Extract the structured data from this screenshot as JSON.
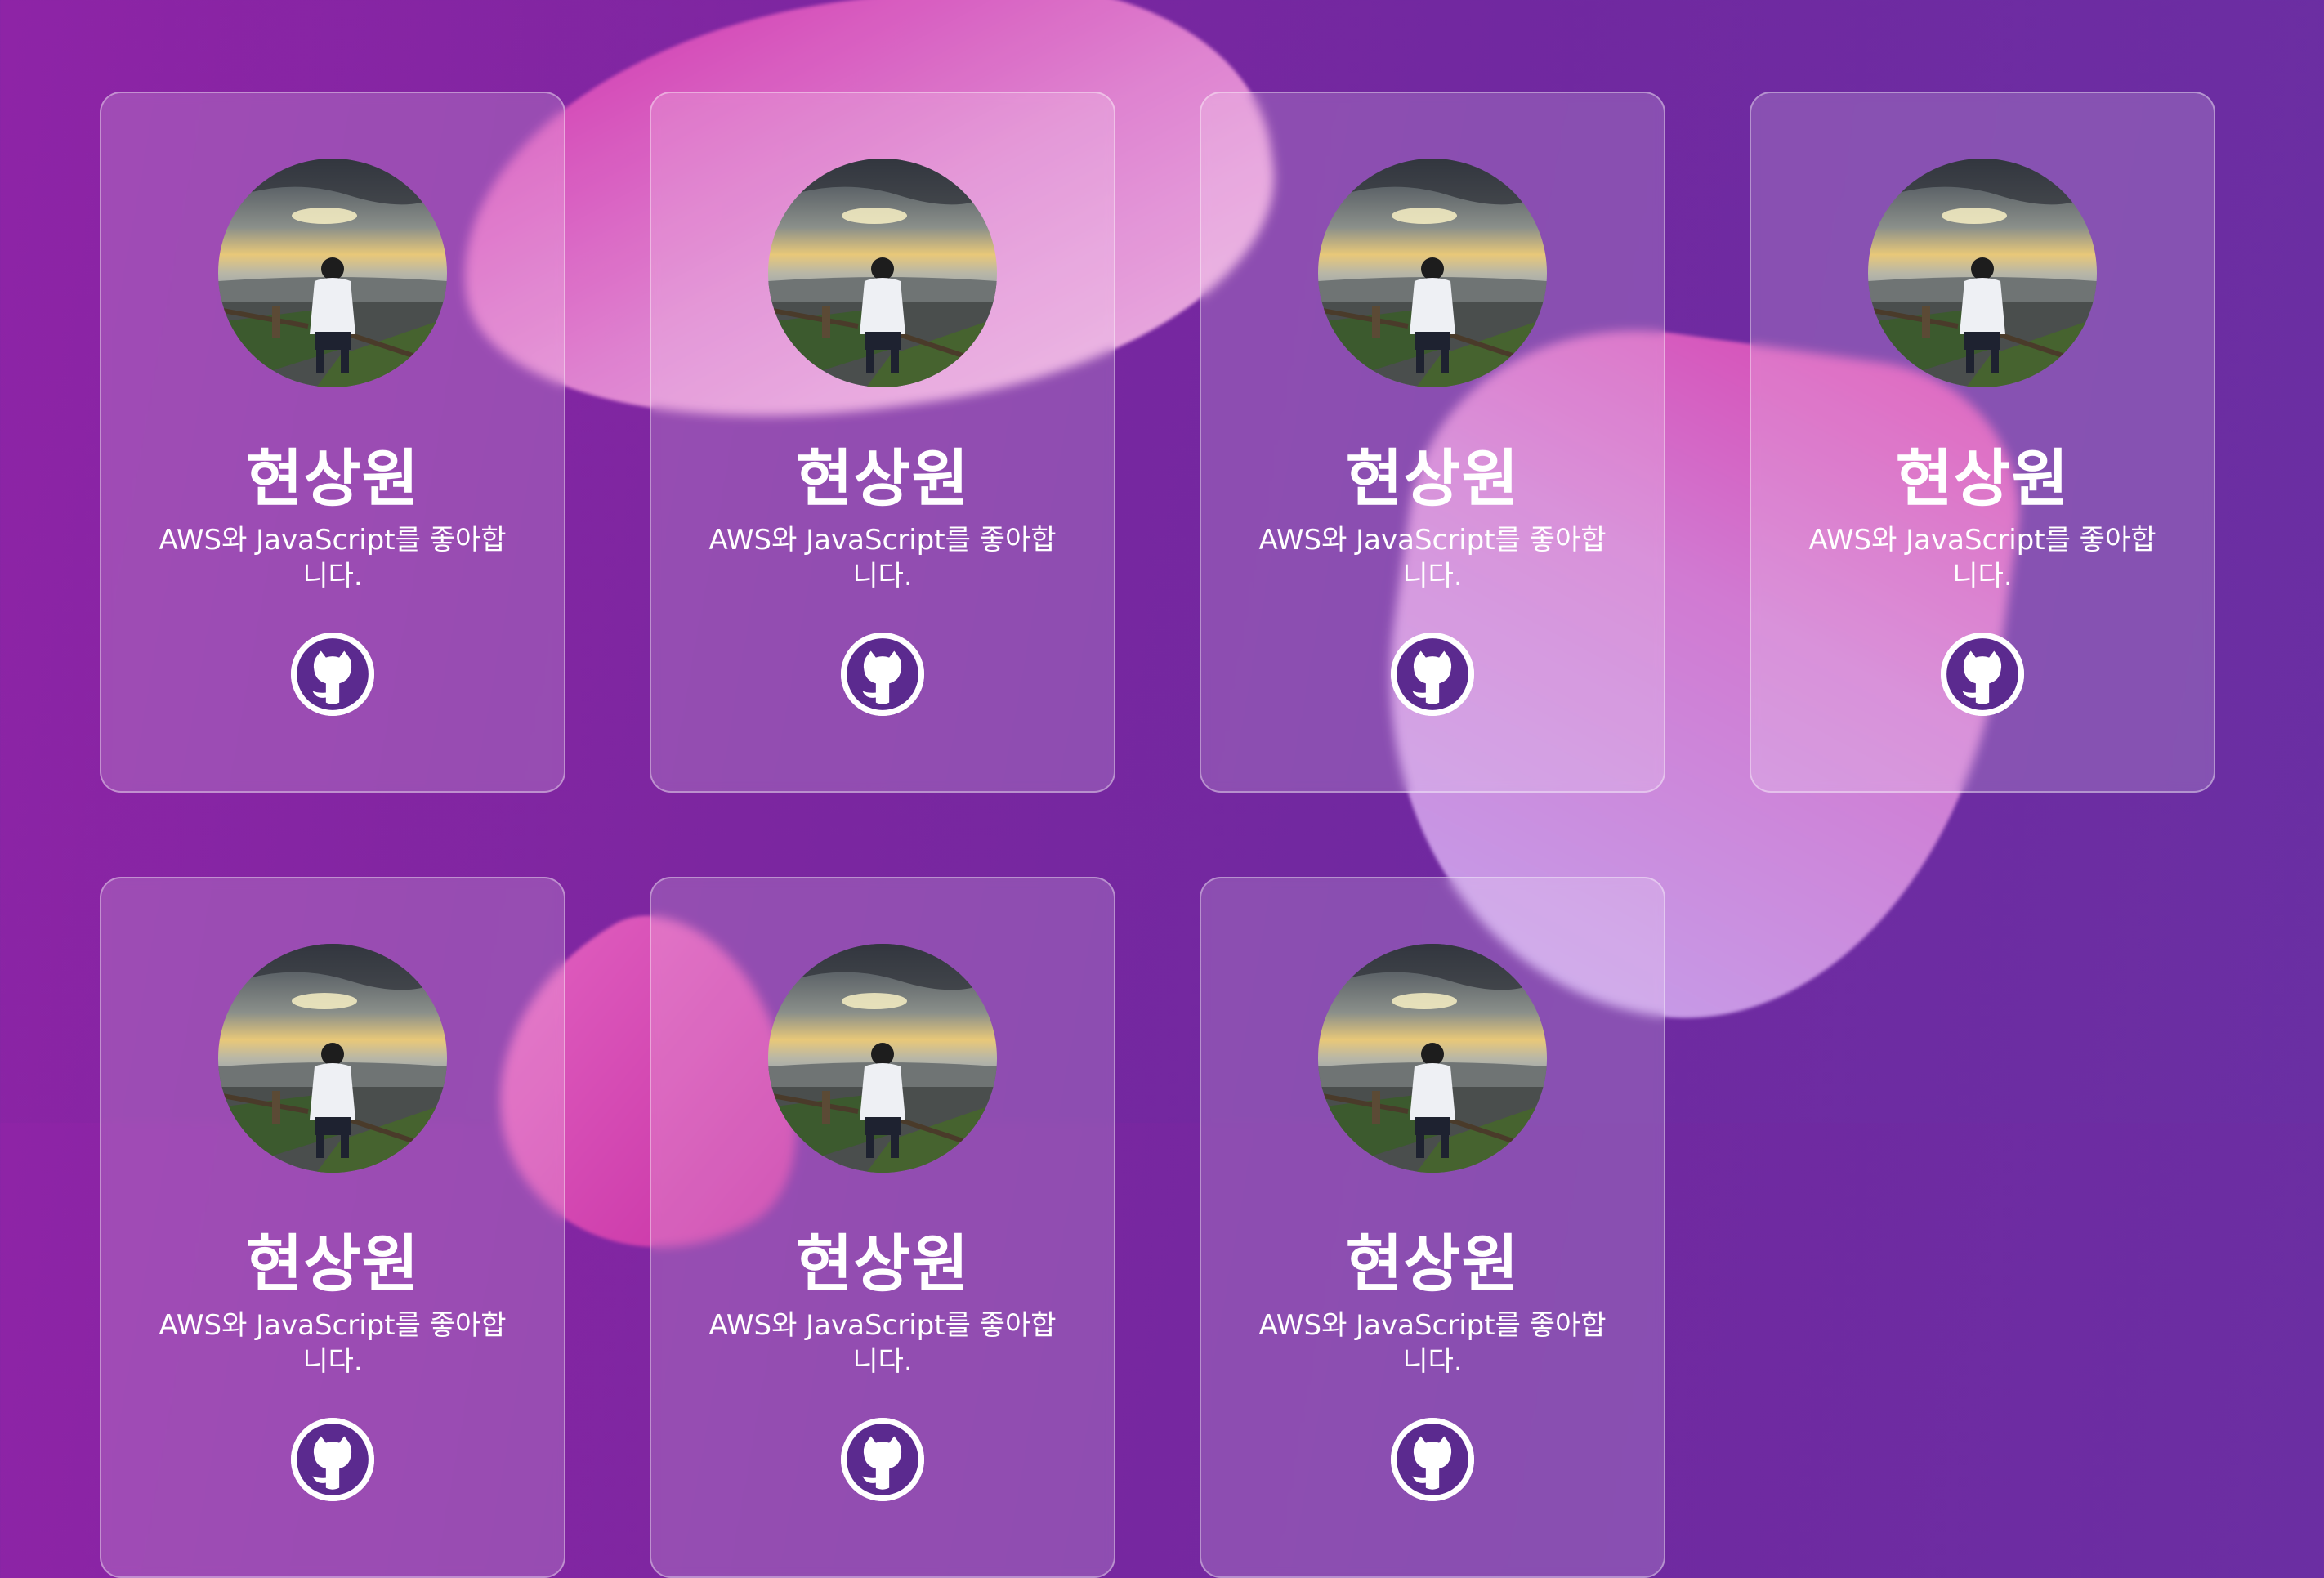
{
  "cards": [
    {
      "name": "현상원",
      "bio": "AWS와 JavaScript를 좋아합니다.",
      "avatar_alt": "profile-photo",
      "link_icon": "github-icon"
    },
    {
      "name": "현상원",
      "bio": "AWS와 JavaScript를 좋아합니다.",
      "avatar_alt": "profile-photo",
      "link_icon": "github-icon"
    },
    {
      "name": "현상원",
      "bio": "AWS와 JavaScript를 좋아합니다.",
      "avatar_alt": "profile-photo",
      "link_icon": "github-icon"
    },
    {
      "name": "현상원",
      "bio": "AWS와 JavaScript를 좋아합니다.",
      "avatar_alt": "profile-photo",
      "link_icon": "github-icon"
    },
    {
      "name": "현상원",
      "bio": "AWS와 JavaScript를 좋아합니다.",
      "avatar_alt": "profile-photo",
      "link_icon": "github-icon"
    },
    {
      "name": "현상원",
      "bio": "AWS와 JavaScript를 좋아합니다.",
      "avatar_alt": "profile-photo",
      "link_icon": "github-icon"
    },
    {
      "name": "현상원",
      "bio": "AWS와 JavaScript를 좋아합니다.",
      "avatar_alt": "profile-photo",
      "link_icon": "github-icon"
    }
  ],
  "colors": {
    "background_start": "#8e24a6",
    "background_end": "#6a2fa3",
    "github_icon": "#5b2a8f"
  }
}
